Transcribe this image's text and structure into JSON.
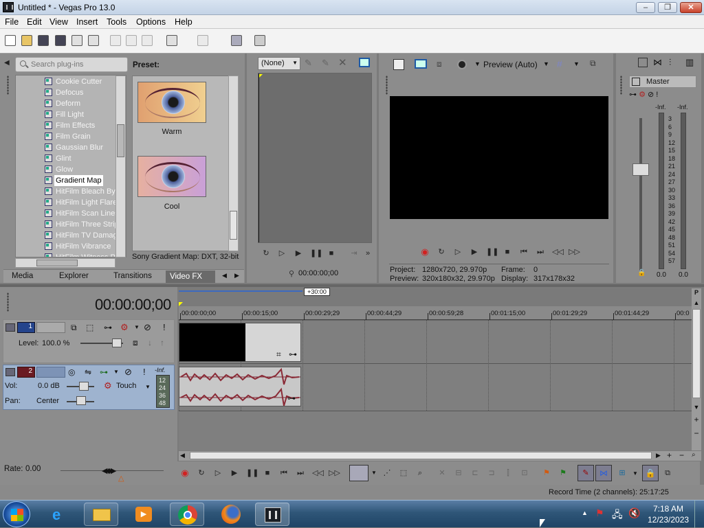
{
  "window": {
    "title": "Untitled * - Vegas Pro 13.0",
    "min": "–",
    "max": "❐",
    "close": "✕"
  },
  "menu": [
    "File",
    "Edit",
    "View",
    "Insert",
    "Tools",
    "Options",
    "Help"
  ],
  "plugins": {
    "search_placeholder": "Search plug-ins",
    "items": [
      "Cookie Cutter",
      "Defocus",
      "Deform",
      "Fill Light",
      "Film Effects",
      "Film Grain",
      "Gaussian Blur",
      "Glint",
      "Glow",
      "Gradient Map",
      "HitFilm Bleach Byp",
      "HitFilm Light Flares",
      "HitFilm Scan Lines",
      "HitFilm Three Strip",
      "HitFilm TV Damage",
      "HitFilm Vibrance",
      "HitFilm Witness Pr"
    ],
    "selected": "Gradient Map"
  },
  "preset": {
    "heading": "Preset:",
    "items": [
      "Warm",
      "Cool"
    ],
    "description": "Sony Gradient Map: DXT, 32-bit"
  },
  "tabs": [
    "Media",
    "Explorer",
    "Transitions",
    "Video FX"
  ],
  "active_tab": "Video FX",
  "trimmer": {
    "dropdown": "(None)",
    "timecode": "00:00:00;00"
  },
  "preview": {
    "mode": "Preview (Auto)",
    "project_label": "Project:",
    "project_value": "1280x720, 29.970p",
    "preview_label": "Preview:",
    "preview_value": "320x180x32, 29.970p",
    "frame_label": "Frame:",
    "frame_value": "0",
    "display_label": "Display:",
    "display_value": "317x178x32"
  },
  "master": {
    "label": "Master",
    "left_inf": "-Inf.",
    "right_inf": "-Inf.",
    "scale": [
      "3",
      "6",
      "9",
      "12",
      "15",
      "18",
      "21",
      "24",
      "27",
      "30",
      "33",
      "36",
      "39",
      "42",
      "45",
      "48",
      "51",
      "54",
      "57"
    ],
    "left_val": "0.0",
    "right_val": "0.0"
  },
  "timeline": {
    "timecode": "00:00:00;00",
    "marker": "+30:00",
    "ruler": [
      "00:00:00;00",
      "00:00:15;00",
      "00:00:29;29",
      "00:00:44;29",
      "00:00:59;28",
      "00:01:15;00",
      "00:01:29;29",
      "00:01:44;29",
      "00:0"
    ]
  },
  "video_track": {
    "number": "1",
    "level_label": "Level:",
    "level_value": "100.0 %"
  },
  "audio_track": {
    "number": "2",
    "vol_label": "Vol:",
    "vol_value": "0.0 dB",
    "pan_label": "Pan:",
    "pan_value": "Center",
    "mode": "Touch",
    "meter_inf": "-Inf.",
    "meter_scale": [
      "12",
      "24",
      "36",
      "48"
    ]
  },
  "rate": {
    "label": "Rate:",
    "value": "0.00"
  },
  "status": {
    "record_time": "Record Time (2 channels): 25:17:25"
  },
  "clock": {
    "time": "7:18 AM",
    "date": "12/23/2023"
  },
  "colors": {
    "bg": "#7b7b7b",
    "accent_selection": "#2b5fd9",
    "audio_wave": "#8a2a36",
    "record_red": "#d22020"
  }
}
